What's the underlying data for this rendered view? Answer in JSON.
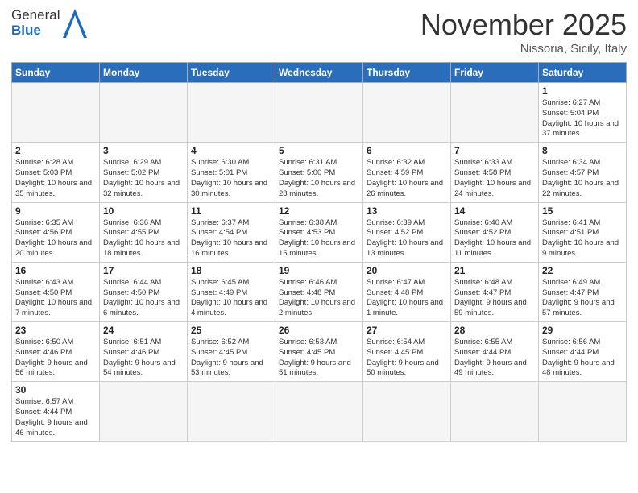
{
  "header": {
    "logo_general": "General",
    "logo_blue": "Blue",
    "month_title": "November 2025",
    "location": "Nissoria, Sicily, Italy"
  },
  "weekdays": [
    "Sunday",
    "Monday",
    "Tuesday",
    "Wednesday",
    "Thursday",
    "Friday",
    "Saturday"
  ],
  "weeks": [
    [
      {
        "day": "",
        "info": ""
      },
      {
        "day": "",
        "info": ""
      },
      {
        "day": "",
        "info": ""
      },
      {
        "day": "",
        "info": ""
      },
      {
        "day": "",
        "info": ""
      },
      {
        "day": "",
        "info": ""
      },
      {
        "day": "1",
        "info": "Sunrise: 6:27 AM\nSunset: 5:04 PM\nDaylight: 10 hours\nand 37 minutes."
      }
    ],
    [
      {
        "day": "2",
        "info": "Sunrise: 6:28 AM\nSunset: 5:03 PM\nDaylight: 10 hours\nand 35 minutes."
      },
      {
        "day": "3",
        "info": "Sunrise: 6:29 AM\nSunset: 5:02 PM\nDaylight: 10 hours\nand 32 minutes."
      },
      {
        "day": "4",
        "info": "Sunrise: 6:30 AM\nSunset: 5:01 PM\nDaylight: 10 hours\nand 30 minutes."
      },
      {
        "day": "5",
        "info": "Sunrise: 6:31 AM\nSunset: 5:00 PM\nDaylight: 10 hours\nand 28 minutes."
      },
      {
        "day": "6",
        "info": "Sunrise: 6:32 AM\nSunset: 4:59 PM\nDaylight: 10 hours\nand 26 minutes."
      },
      {
        "day": "7",
        "info": "Sunrise: 6:33 AM\nSunset: 4:58 PM\nDaylight: 10 hours\nand 24 minutes."
      },
      {
        "day": "8",
        "info": "Sunrise: 6:34 AM\nSunset: 4:57 PM\nDaylight: 10 hours\nand 22 minutes."
      }
    ],
    [
      {
        "day": "9",
        "info": "Sunrise: 6:35 AM\nSunset: 4:56 PM\nDaylight: 10 hours\nand 20 minutes."
      },
      {
        "day": "10",
        "info": "Sunrise: 6:36 AM\nSunset: 4:55 PM\nDaylight: 10 hours\nand 18 minutes."
      },
      {
        "day": "11",
        "info": "Sunrise: 6:37 AM\nSunset: 4:54 PM\nDaylight: 10 hours\nand 16 minutes."
      },
      {
        "day": "12",
        "info": "Sunrise: 6:38 AM\nSunset: 4:53 PM\nDaylight: 10 hours\nand 15 minutes."
      },
      {
        "day": "13",
        "info": "Sunrise: 6:39 AM\nSunset: 4:52 PM\nDaylight: 10 hours\nand 13 minutes."
      },
      {
        "day": "14",
        "info": "Sunrise: 6:40 AM\nSunset: 4:52 PM\nDaylight: 10 hours\nand 11 minutes."
      },
      {
        "day": "15",
        "info": "Sunrise: 6:41 AM\nSunset: 4:51 PM\nDaylight: 10 hours\nand 9 minutes."
      }
    ],
    [
      {
        "day": "16",
        "info": "Sunrise: 6:43 AM\nSunset: 4:50 PM\nDaylight: 10 hours\nand 7 minutes."
      },
      {
        "day": "17",
        "info": "Sunrise: 6:44 AM\nSunset: 4:50 PM\nDaylight: 10 hours\nand 6 minutes."
      },
      {
        "day": "18",
        "info": "Sunrise: 6:45 AM\nSunset: 4:49 PM\nDaylight: 10 hours\nand 4 minutes."
      },
      {
        "day": "19",
        "info": "Sunrise: 6:46 AM\nSunset: 4:48 PM\nDaylight: 10 hours\nand 2 minutes."
      },
      {
        "day": "20",
        "info": "Sunrise: 6:47 AM\nSunset: 4:48 PM\nDaylight: 10 hours\nand 1 minute."
      },
      {
        "day": "21",
        "info": "Sunrise: 6:48 AM\nSunset: 4:47 PM\nDaylight: 9 hours\nand 59 minutes."
      },
      {
        "day": "22",
        "info": "Sunrise: 6:49 AM\nSunset: 4:47 PM\nDaylight: 9 hours\nand 57 minutes."
      }
    ],
    [
      {
        "day": "23",
        "info": "Sunrise: 6:50 AM\nSunset: 4:46 PM\nDaylight: 9 hours\nand 56 minutes."
      },
      {
        "day": "24",
        "info": "Sunrise: 6:51 AM\nSunset: 4:46 PM\nDaylight: 9 hours\nand 54 minutes."
      },
      {
        "day": "25",
        "info": "Sunrise: 6:52 AM\nSunset: 4:45 PM\nDaylight: 9 hours\nand 53 minutes."
      },
      {
        "day": "26",
        "info": "Sunrise: 6:53 AM\nSunset: 4:45 PM\nDaylight: 9 hours\nand 51 minutes."
      },
      {
        "day": "27",
        "info": "Sunrise: 6:54 AM\nSunset: 4:45 PM\nDaylight: 9 hours\nand 50 minutes."
      },
      {
        "day": "28",
        "info": "Sunrise: 6:55 AM\nSunset: 4:44 PM\nDaylight: 9 hours\nand 49 minutes."
      },
      {
        "day": "29",
        "info": "Sunrise: 6:56 AM\nSunset: 4:44 PM\nDaylight: 9 hours\nand 48 minutes."
      }
    ],
    [
      {
        "day": "30",
        "info": "Sunrise: 6:57 AM\nSunset: 4:44 PM\nDaylight: 9 hours\nand 46 minutes."
      },
      {
        "day": "",
        "info": ""
      },
      {
        "day": "",
        "info": ""
      },
      {
        "day": "",
        "info": ""
      },
      {
        "day": "",
        "info": ""
      },
      {
        "day": "",
        "info": ""
      },
      {
        "day": "",
        "info": ""
      }
    ]
  ]
}
